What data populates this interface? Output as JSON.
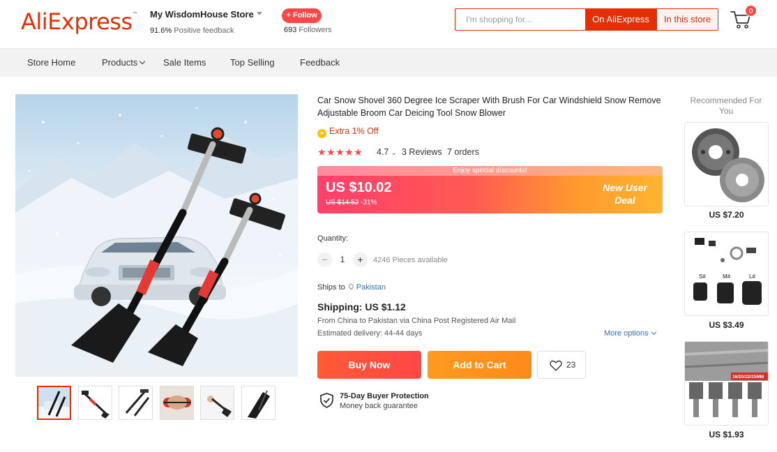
{
  "header": {
    "logo": "AliExpress",
    "store_name": "My WisdomHouse Store",
    "feedback_pct": "91.6%",
    "feedback_label": "Positive feedback",
    "follow_label": "+ Follow",
    "followers_count": "693",
    "followers_label": "Followers",
    "search_placeholder": "I'm shopping for...",
    "search_on_ali": "On AliExpress",
    "search_in_store": "In this store",
    "cart_count": "0",
    "colors": {
      "brand": "#e62e04",
      "accent": "#ff4747"
    }
  },
  "nav": {
    "items": [
      "Store Home",
      "Products",
      "Sale Items",
      "Top Selling",
      "Feedback"
    ]
  },
  "product": {
    "title": "Car Snow Shovel 360 Degree Ice Scraper With Brush For Car Windshield Snow Remove Adjustable Broom Car Deicing Tool Snow Blower",
    "extra_off": "Extra 1% Off",
    "stars": "★★★★★",
    "rating": "4.7",
    "reviews": "3 Reviews",
    "orders": "7 orders",
    "price_banner": "Enjoy special discounts!",
    "price": "US $10.02",
    "old_price": "US $14.52",
    "discount": "-31%",
    "deal_line1": "New User",
    "deal_line2": "Deal",
    "quantity_label": "Quantity:",
    "quantity_minus": "−",
    "quantity_value": "1",
    "quantity_plus": "+",
    "available": "4246 Pieces available",
    "ships_to_label": "Ships to",
    "ships_to_country": "Pakistan",
    "shipping": "Shipping: US $1.12",
    "ship_from": "From China to Pakistan via China Post Registered Air Mail",
    "ship_estimate": "Estimated delivery: 44-44 days",
    "more_options": "More options",
    "buy_now": "Buy Now",
    "add_to_cart": "Add to Cart",
    "wishlist_count": "23",
    "protection_title": "75-Day Buyer Protection",
    "protection_sub": "Money back guarantee"
  },
  "recommended": {
    "title": "Recommended For You",
    "items": [
      {
        "price": "US $7.20",
        "icon": "grinder-nut-icon"
      },
      {
        "price": "US $3.49",
        "icon": "socket-set-icon"
      },
      {
        "price": "US $1.93",
        "icon": "drill-bits-icon",
        "badge": "16/20/22/25MM"
      }
    ]
  }
}
